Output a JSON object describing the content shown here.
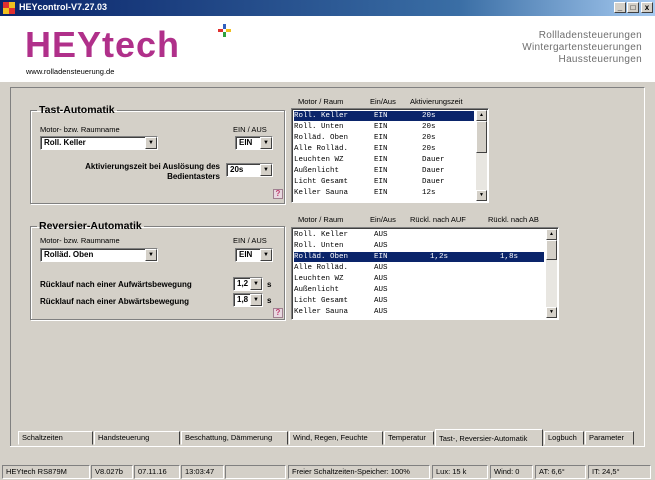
{
  "window": {
    "title": "HEYcontrol-V7.27.03",
    "min_glyph": "_",
    "max_glyph": "□",
    "close_glyph": "x"
  },
  "header": {
    "logo_text": "HEYtech",
    "url": "www.rolladensteuerung.de",
    "taglines": [
      "Rollladensteuerungen",
      "Wintergartensteuerungen",
      "Haussteuerungen"
    ],
    "logo_color": "#b0308a"
  },
  "tast": {
    "legend": "Tast-Automatik",
    "motor_label": "Motor- bzw. Raumname",
    "motor_value": "Roll. Keller",
    "ein_aus_label": "EIN / AUS",
    "ein_aus_value": "EIN",
    "zeit_label": "Aktivierungszeit bei Auslösung des Bedientasters",
    "zeit_value": "20s",
    "help": "?"
  },
  "tast_list": {
    "headers": [
      "Motor / Raum",
      "Ein/Aus",
      "Aktivierungszeit"
    ],
    "rows": [
      [
        "Roll. Keller",
        "EIN",
        "20s"
      ],
      [
        "Roll. Unten",
        "EIN",
        "20s"
      ],
      [
        "Rolläd. Oben",
        "EIN",
        "20s"
      ],
      [
        "Alle Rolläd.",
        "EIN",
        "20s"
      ],
      [
        "Leuchten WZ",
        "EIN",
        "Dauer"
      ],
      [
        "Außenlicht",
        "EIN",
        "Dauer"
      ],
      [
        "Licht Gesamt",
        "EIN",
        "Dauer"
      ],
      [
        "Keller Sauna",
        "EIN",
        "12s"
      ]
    ],
    "selected": 0
  },
  "rev": {
    "legend": "Reversier-Automatik",
    "motor_label": "Motor- bzw. Raumname",
    "motor_value": "Rolläd. Oben",
    "ein_aus_label": "EIN / AUS",
    "ein_aus_value": "EIN",
    "auf_label": "Rücklauf nach einer Aufwärtsbewegung",
    "auf_value": "1,2",
    "ab_label": "Rücklauf nach einer Abwärtsbewegung",
    "ab_value": "1,8",
    "unit": "s",
    "help": "?"
  },
  "rev_list": {
    "headers": [
      "Motor / Raum",
      "Ein/Aus",
      "Rückl. nach AUF",
      "Rückl. nach AB"
    ],
    "rows": [
      [
        "Roll. Keller",
        "AUS",
        "",
        ""
      ],
      [
        "Roll. Unten",
        "AUS",
        "",
        ""
      ],
      [
        "Rolläd. Oben",
        "EIN",
        "1,2s",
        "1,8s"
      ],
      [
        "Alle Rolläd.",
        "AUS",
        "",
        ""
      ],
      [
        "Leuchten WZ",
        "AUS",
        "",
        ""
      ],
      [
        "Außenlicht",
        "AUS",
        "",
        ""
      ],
      [
        "Licht Gesamt",
        "AUS",
        "",
        ""
      ],
      [
        "Keller Sauna",
        "AUS",
        "",
        ""
      ]
    ],
    "selected": 2
  },
  "tabs": [
    "Schaltzeiten",
    "Handsteuerung",
    "Beschattung, Dämmerung",
    "Wind, Regen, Feuchte",
    "Temperatur",
    "Tast-, Reversier-Automatik",
    "Logbuch",
    "Parameter"
  ],
  "active_tab": 5,
  "status": [
    "HEYtech RS879M",
    "V8.027b",
    "07.11.16",
    "13:03:47",
    "",
    "Freier Schaltzeiten-Speicher: 100%",
    "Lux:  15 k",
    "Wind: 0",
    "AT: 6,6°",
    "IT: 24,5°"
  ]
}
